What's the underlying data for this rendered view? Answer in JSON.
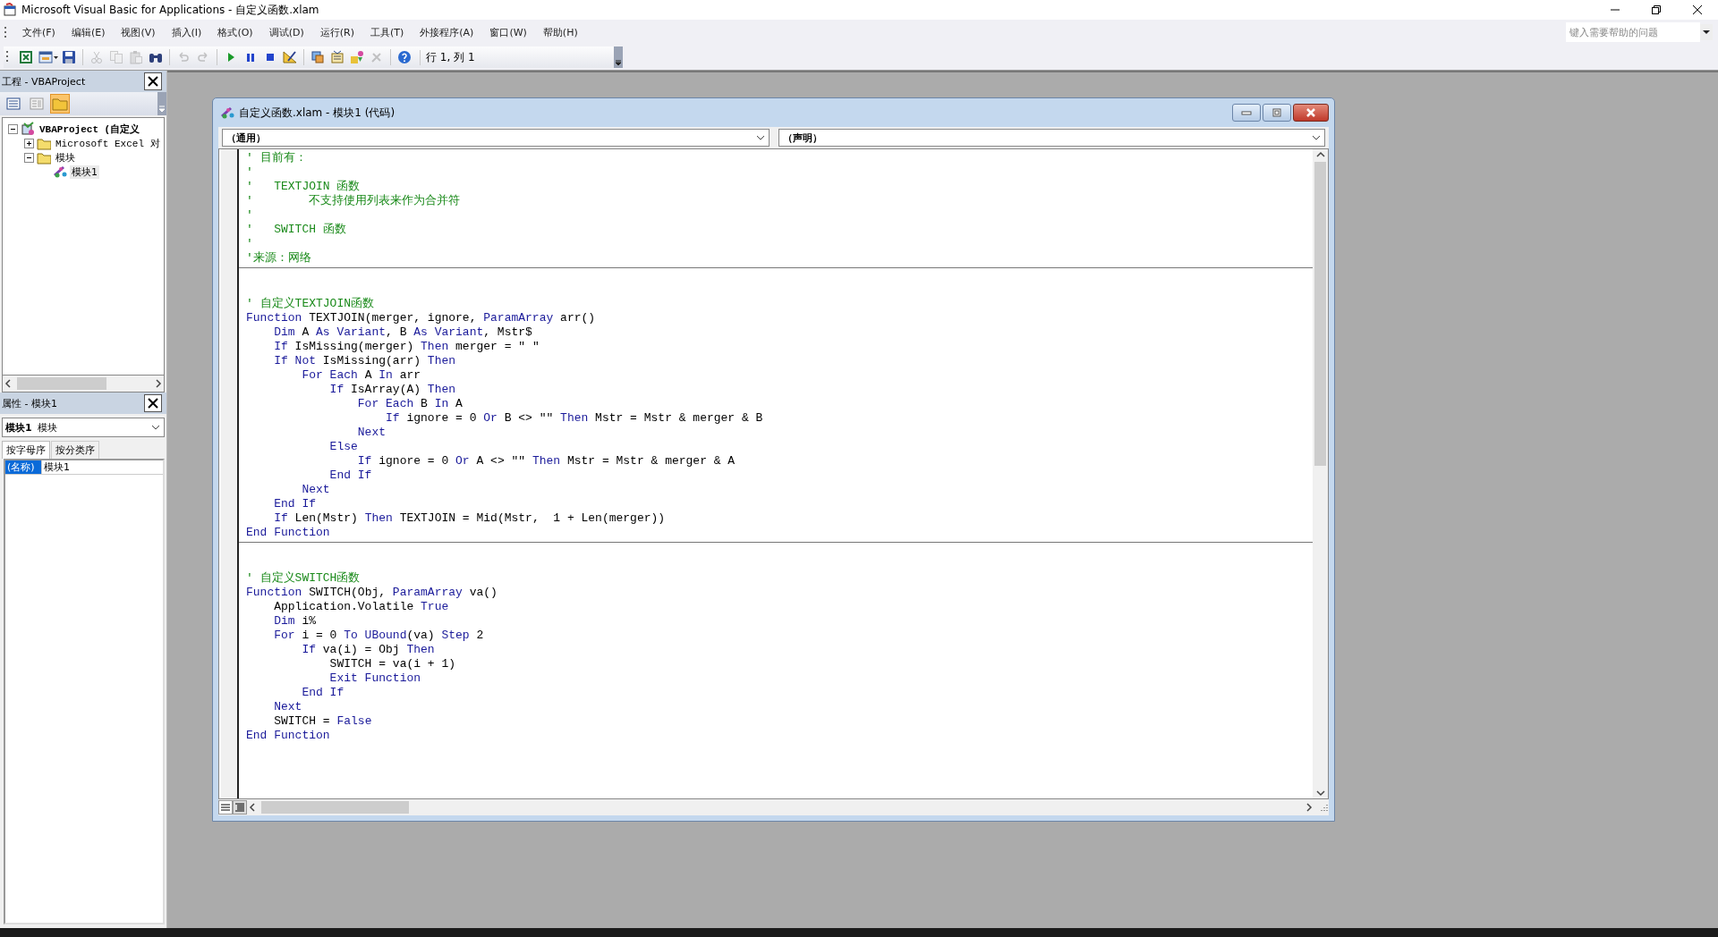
{
  "window": {
    "title": "Microsoft Visual Basic for Applications - 自定义函数.xlam"
  },
  "menu": [
    {
      "label": "文件(F)"
    },
    {
      "label": "编辑(E)"
    },
    {
      "label": "视图(V)"
    },
    {
      "label": "插入(I)"
    },
    {
      "label": "格式(O)"
    },
    {
      "label": "调试(D)"
    },
    {
      "label": "运行(R)"
    },
    {
      "label": "工具(T)"
    },
    {
      "label": "外接程序(A)"
    },
    {
      "label": "窗口(W)"
    },
    {
      "label": "帮助(H)"
    }
  ],
  "help_box": {
    "placeholder": "键入需要帮助的问题"
  },
  "toolbar": {
    "buttons": [
      {
        "kind": "excel",
        "disabled": false
      },
      {
        "kind": "userform",
        "disabled": false
      },
      {
        "kind": "save",
        "disabled": false
      },
      {
        "kind": "cut",
        "disabled": true
      },
      {
        "kind": "copy",
        "disabled": true
      },
      {
        "kind": "paste",
        "disabled": true
      },
      {
        "kind": "find",
        "disabled": false
      },
      {
        "kind": "undo",
        "disabled": true
      },
      {
        "kind": "redo",
        "disabled": true
      },
      {
        "kind": "run",
        "disabled": false
      },
      {
        "kind": "pause",
        "disabled": false
      },
      {
        "kind": "stop",
        "disabled": false
      },
      {
        "kind": "design",
        "disabled": false
      },
      {
        "kind": "project",
        "disabled": false
      },
      {
        "kind": "properties",
        "disabled": false
      },
      {
        "kind": "browser",
        "disabled": false
      },
      {
        "kind": "toolbox",
        "disabled": true
      },
      {
        "kind": "help",
        "disabled": false
      }
    ],
    "position": "行 1, 列 1"
  },
  "project_panel": {
    "title": "工程 - VBAProject",
    "tree": [
      {
        "label": "VBAProject (自定义",
        "kind": "project",
        "expanded": true,
        "selected": false,
        "children": [
          {
            "label": "Microsoft Excel 对",
            "kind": "folder",
            "expanded": false,
            "selected": false
          },
          {
            "label": "模块",
            "kind": "folder",
            "expanded": true,
            "selected": false,
            "children": [
              {
                "label": "模块1",
                "kind": "module",
                "selected": true
              }
            ]
          }
        ]
      }
    ]
  },
  "properties_panel": {
    "title": "属性 - 模块1",
    "object": {
      "name": "模块1",
      "type": "模块"
    },
    "tabs": [
      {
        "label": "按字母序",
        "selected": true
      },
      {
        "label": "按分类序",
        "selected": false
      }
    ],
    "rows": [
      {
        "name": "(名称)",
        "value": "模块1",
        "selected": true
      }
    ]
  },
  "code_window": {
    "title": "自定义函数.xlam - 模块1 (代码)",
    "object_dropdown": "（通用）",
    "procedure_dropdown": "（声明）",
    "sections": [
      {
        "lines": [
          [
            {
              "text": "' 目前有：",
              "kind": "comment"
            }
          ],
          [
            {
              "text": "'",
              "kind": "comment"
            }
          ],
          [
            {
              "text": "'   TEXTJOIN 函数",
              "kind": "comment"
            }
          ],
          [
            {
              "text": "'        不支持使用列表来作为合并符",
              "kind": "comment"
            }
          ],
          [
            {
              "text": "'",
              "kind": "comment"
            }
          ],
          [
            {
              "text": "'   SWITCH 函数",
              "kind": "comment"
            }
          ],
          [
            {
              "text": "'",
              "kind": "comment"
            }
          ],
          [
            {
              "text": "'来源：网络",
              "kind": "comment"
            }
          ]
        ]
      },
      {
        "lines": [
          [
            {
              "text": "' 自定义TEXTJOIN函数",
              "kind": "comment"
            }
          ],
          [
            {
              "text": "Function",
              "kind": "keyword"
            },
            {
              "text": " TEXTJOIN(merger, ignore, ",
              "kind": "plain"
            },
            {
              "text": "ParamArray",
              "kind": "keyword"
            },
            {
              "text": " arr()",
              "kind": "plain"
            }
          ],
          [
            {
              "text": "    Dim",
              "kind": "keyword"
            },
            {
              "text": " A ",
              "kind": "plain"
            },
            {
              "text": "As Variant",
              "kind": "keyword"
            },
            {
              "text": ", B ",
              "kind": "plain"
            },
            {
              "text": "As Variant",
              "kind": "keyword"
            },
            {
              "text": ", Mstr$",
              "kind": "plain"
            }
          ],
          [
            {
              "text": "    If",
              "kind": "keyword"
            },
            {
              "text": " IsMissing(merger) ",
              "kind": "plain"
            },
            {
              "text": "Then",
              "kind": "keyword"
            },
            {
              "text": " merger = \" \"",
              "kind": "plain"
            }
          ],
          [
            {
              "text": "    If Not",
              "kind": "keyword"
            },
            {
              "text": " IsMissing(arr) ",
              "kind": "plain"
            },
            {
              "text": "Then",
              "kind": "keyword"
            }
          ],
          [
            {
              "text": "        For Each",
              "kind": "keyword"
            },
            {
              "text": " A ",
              "kind": "plain"
            },
            {
              "text": "In",
              "kind": "keyword"
            },
            {
              "text": " arr",
              "kind": "plain"
            }
          ],
          [
            {
              "text": "            If",
              "kind": "keyword"
            },
            {
              "text": " IsArray(A) ",
              "kind": "plain"
            },
            {
              "text": "Then",
              "kind": "keyword"
            }
          ],
          [
            {
              "text": "                For Each",
              "kind": "keyword"
            },
            {
              "text": " B ",
              "kind": "plain"
            },
            {
              "text": "In",
              "kind": "keyword"
            },
            {
              "text": " A",
              "kind": "plain"
            }
          ],
          [
            {
              "text": "                    If",
              "kind": "keyword"
            },
            {
              "text": " ignore = 0 ",
              "kind": "plain"
            },
            {
              "text": "Or",
              "kind": "keyword"
            },
            {
              "text": " B <> \"\" ",
              "kind": "plain"
            },
            {
              "text": "Then",
              "kind": "keyword"
            },
            {
              "text": " Mstr = Mstr & merger & B",
              "kind": "plain"
            }
          ],
          [
            {
              "text": "                Next",
              "kind": "keyword"
            }
          ],
          [
            {
              "text": "            Else",
              "kind": "keyword"
            }
          ],
          [
            {
              "text": "                If",
              "kind": "keyword"
            },
            {
              "text": " ignore = 0 ",
              "kind": "plain"
            },
            {
              "text": "Or",
              "kind": "keyword"
            },
            {
              "text": " A <> \"\" ",
              "kind": "plain"
            },
            {
              "text": "Then",
              "kind": "keyword"
            },
            {
              "text": " Mstr = Mstr & merger & A",
              "kind": "plain"
            }
          ],
          [
            {
              "text": "            End If",
              "kind": "keyword"
            }
          ],
          [
            {
              "text": "        Next",
              "kind": "keyword"
            }
          ],
          [
            {
              "text": "    End If",
              "kind": "keyword"
            }
          ],
          [
            {
              "text": "    If",
              "kind": "keyword"
            },
            {
              "text": " Len(Mstr) ",
              "kind": "plain"
            },
            {
              "text": "Then",
              "kind": "keyword"
            },
            {
              "text": " TEXTJOIN = Mid(Mstr,  1 + Len(merger))",
              "kind": "plain"
            }
          ],
          [
            {
              "text": "End Function",
              "kind": "keyword"
            }
          ]
        ]
      },
      {
        "lines": [
          [
            {
              "text": "' 自定义SWITCH函数",
              "kind": "comment"
            }
          ],
          [
            {
              "text": "Function",
              "kind": "keyword"
            },
            {
              "text": " SWITCH(Obj, ",
              "kind": "plain"
            },
            {
              "text": "ParamArray",
              "kind": "keyword"
            },
            {
              "text": " va()",
              "kind": "plain"
            }
          ],
          [
            {
              "text": "    Application.Volatile ",
              "kind": "plain"
            },
            {
              "text": "True",
              "kind": "keyword"
            }
          ],
          [
            {
              "text": "    Dim",
              "kind": "keyword"
            },
            {
              "text": " i%",
              "kind": "plain"
            }
          ],
          [
            {
              "text": "    For",
              "kind": "keyword"
            },
            {
              "text": " i = 0 ",
              "kind": "plain"
            },
            {
              "text": "To UBound",
              "kind": "keyword"
            },
            {
              "text": "(va) ",
              "kind": "plain"
            },
            {
              "text": "Step",
              "kind": "keyword"
            },
            {
              "text": " 2",
              "kind": "plain"
            }
          ],
          [
            {
              "text": "        If",
              "kind": "keyword"
            },
            {
              "text": " va(i) = Obj ",
              "kind": "plain"
            },
            {
              "text": "Then",
              "kind": "keyword"
            }
          ],
          [
            {
              "text": "            SWITCH = va(i + 1)",
              "kind": "plain"
            }
          ],
          [
            {
              "text": "            Exit Function",
              "kind": "keyword"
            }
          ],
          [
            {
              "text": "        End If",
              "kind": "keyword"
            }
          ],
          [
            {
              "text": "    Next",
              "kind": "keyword"
            }
          ],
          [
            {
              "text": "    SWITCH = ",
              "kind": "plain"
            },
            {
              "text": "False",
              "kind": "keyword"
            }
          ],
          [
            {
              "text": "End Function",
              "kind": "keyword"
            }
          ]
        ]
      }
    ]
  }
}
